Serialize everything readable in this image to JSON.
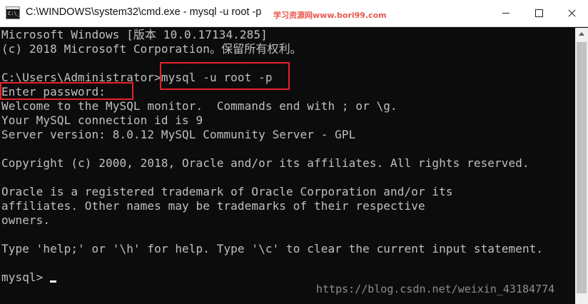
{
  "window": {
    "title": "C:\\WINDOWS\\system32\\cmd.exe - mysql  -u root  -p",
    "watermark_top": "学习资源网www.bori99.com"
  },
  "console": {
    "lines": [
      "Microsoft Windows [版本 10.0.17134.285]",
      "(c) 2018 Microsoft Corporation。保留所有权利。",
      "",
      "C:\\Users\\Administrator>mysql -u root -p",
      "Enter password:",
      "Welcome to the MySQL monitor.  Commands end with ; or \\g.",
      "Your MySQL connection id is 9",
      "Server version: 8.0.12 MySQL Community Server - GPL",
      "",
      "Copyright (c) 2000, 2018, Oracle and/or its affiliates. All rights reserved.",
      "",
      "Oracle is a registered trademark of Oracle Corporation and/or its",
      "affiliates. Other names may be trademarks of their respective",
      "owners.",
      "",
      "Type 'help;' or '\\h' for help. Type '\\c' to clear the current input statement.",
      "",
      "mysql> "
    ]
  },
  "watermark_bottom": "https://blog.csdn.net/weixin_43184774",
  "colors": {
    "console_bg": "#0c0c0c",
    "console_text": "#c0c0c0",
    "highlight": "#e8202a"
  }
}
